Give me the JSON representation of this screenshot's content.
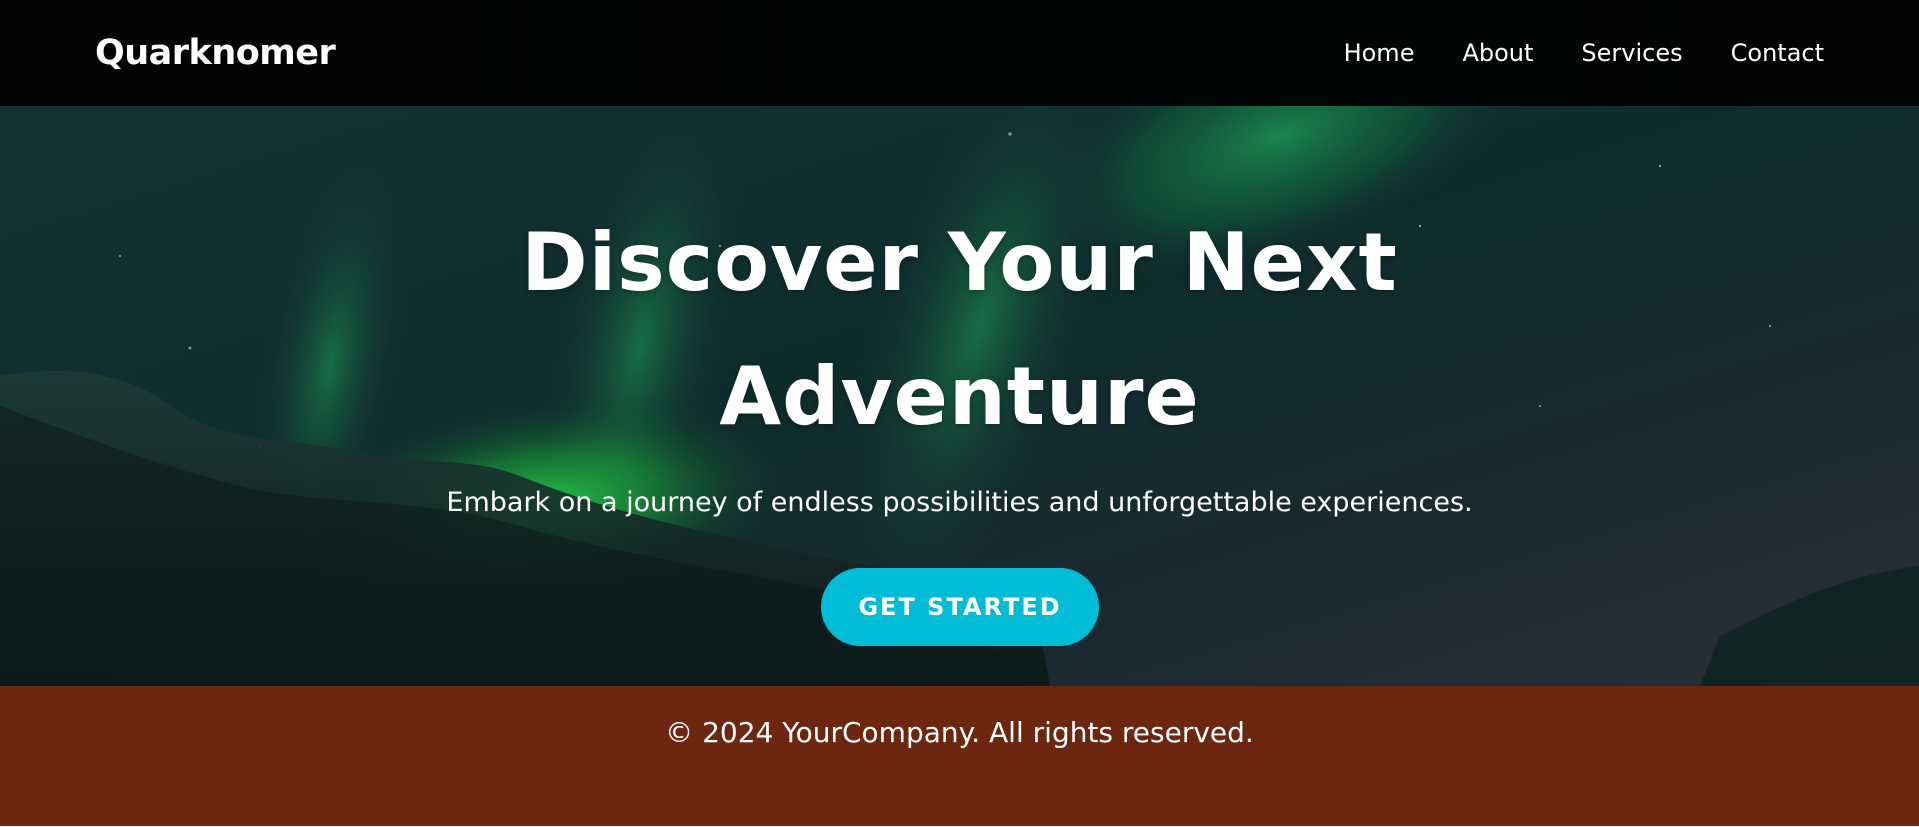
{
  "navbar": {
    "brand": "Quarknomer",
    "links": [
      {
        "label": "Home"
      },
      {
        "label": "About"
      },
      {
        "label": "Services"
      },
      {
        "label": "Contact"
      }
    ]
  },
  "hero": {
    "title_line1": "Discover Your Next",
    "title_line2": "Adventure",
    "subtitle": "Embark on a journey of endless possibilities and unforgettable experiences.",
    "cta_label": "GET STARTED",
    "background": "aurora-night-sky-image"
  },
  "footer": {
    "copyright": "© 2024 YourCompany. All rights reserved."
  },
  "colors": {
    "navbar_bg": "#020303",
    "cta_bg": "#00bcd4",
    "footer_bg": "#6d2610",
    "text": "#ffffff"
  }
}
